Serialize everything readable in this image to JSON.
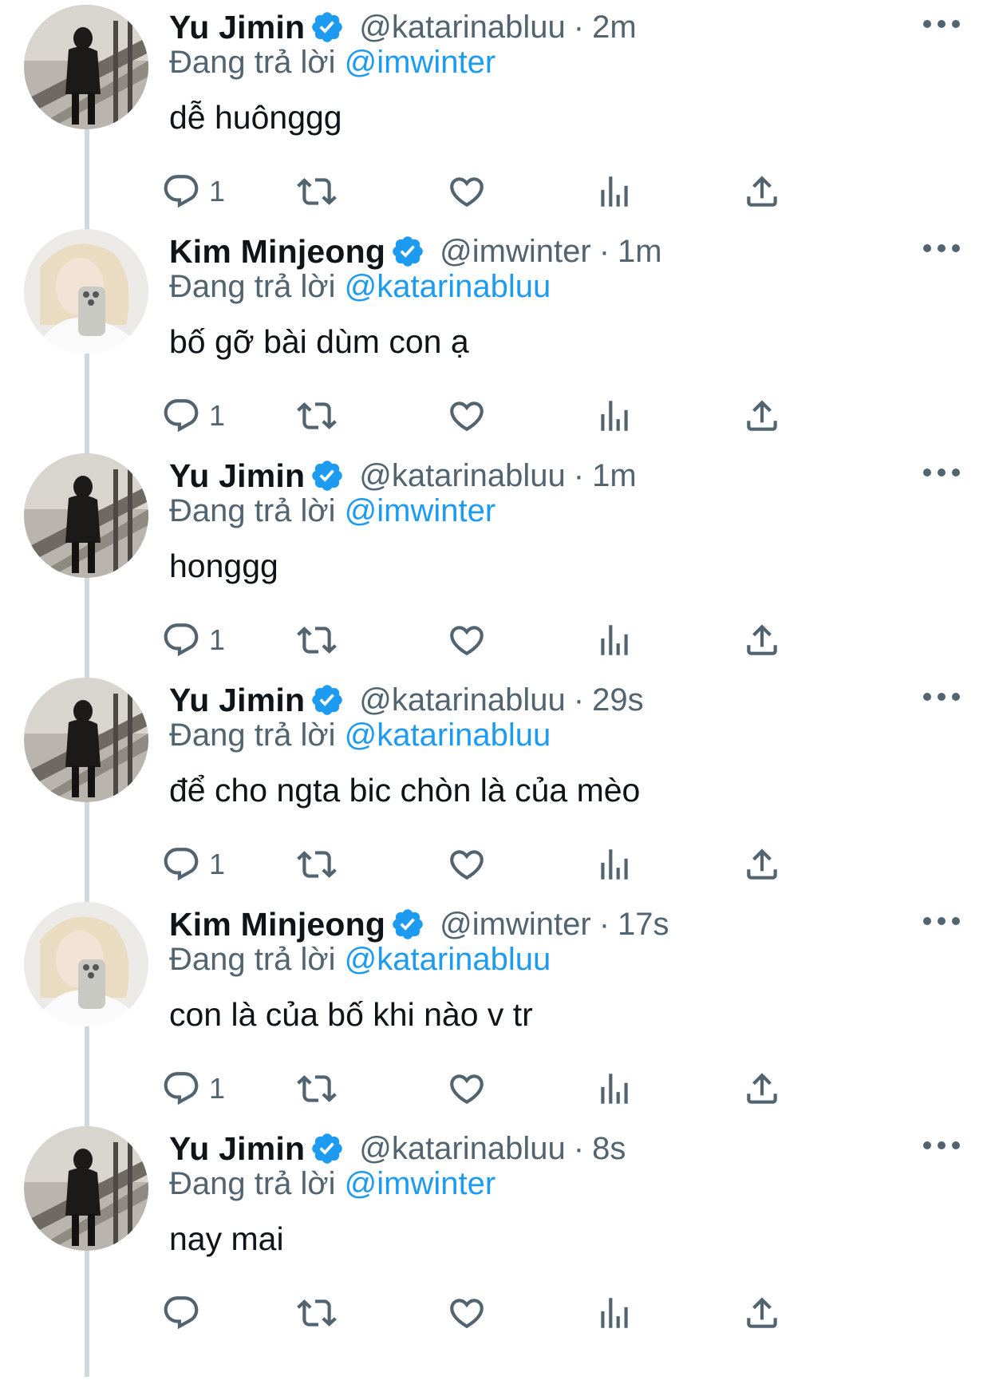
{
  "reply_prefix": "Đang trả lời",
  "colors": {
    "accent": "#1d9bf0",
    "secondary_text": "#536471",
    "thread_line": "#cfd9de"
  },
  "tweets": [
    {
      "name": "Yu Jimin",
      "handle": "@katarinabluu",
      "sep": "·",
      "time": "2m",
      "reply_to": "@imwinter",
      "text": "dễ huônggg",
      "reply_count": "1",
      "avatar": "jimin"
    },
    {
      "name": "Kim Minjeong",
      "handle": "@imwinter",
      "sep": "·",
      "time": "1m",
      "reply_to": "@katarinabluu",
      "text": "bố gỡ bài dùm con ạ",
      "reply_count": "1",
      "avatar": "minjeong"
    },
    {
      "name": "Yu Jimin",
      "handle": "@katarinabluu",
      "sep": "·",
      "time": "1m",
      "reply_to": "@imwinter",
      "text": "honggg",
      "reply_count": "1",
      "avatar": "jimin"
    },
    {
      "name": "Yu Jimin",
      "handle": "@katarinabluu",
      "sep": "·",
      "time": "29s",
      "reply_to": "@katarinabluu",
      "text": "để cho ngta bic chòn là của mèo",
      "reply_count": "1",
      "avatar": "jimin"
    },
    {
      "name": "Kim Minjeong",
      "handle": "@imwinter",
      "sep": "·",
      "time": "17s",
      "reply_to": "@katarinabluu",
      "text": "con là của bố khi nào v tr",
      "reply_count": "1",
      "avatar": "minjeong"
    },
    {
      "name": "Yu Jimin",
      "handle": "@katarinabluu",
      "sep": "·",
      "time": "8s",
      "reply_to": "@imwinter",
      "text": "nay mai",
      "reply_count": "",
      "avatar": "jimin"
    }
  ],
  "icons": [
    "verified-badge-icon",
    "more-options-icon",
    "reply-icon",
    "retweet-icon",
    "like-icon",
    "views-icon",
    "share-icon"
  ]
}
